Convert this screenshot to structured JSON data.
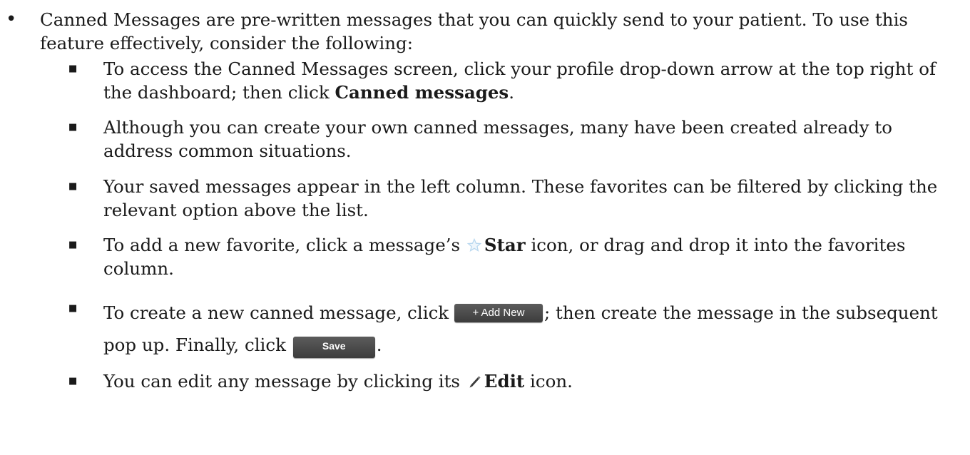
{
  "intro": {
    "text": "Canned Messages are pre-written messages that you can quickly send to your patient. To use this feature effectively, consider the following:"
  },
  "items": [
    {
      "pre": "To access the Canned Messages screen, click your profile drop-down arrow at the top right of the dashboard; then click ",
      "bold": "Canned messages",
      "post": "."
    },
    {
      "text": "Although you can create your own canned messages, many have been created already to address common situations."
    },
    {
      "text": "Your saved messages appear in the left column. These favorites can be filtered by clicking the relevant option above the list."
    },
    {
      "pre": "To add a new favorite, click a message’s ",
      "icon": "star-icon",
      "bold": "Star",
      "post": " icon, or drag and drop it into the favorites column."
    },
    {
      "pre": "To create a new canned message, click ",
      "button1": "+ Add New",
      "mid": "; then create the message in the subsequent pop up. Finally, click ",
      "button2": "Save",
      "post": "."
    },
    {
      "pre": "You can edit any message by clicking its ",
      "icon": "pencil-icon",
      "bold": "Edit",
      "post": " icon."
    }
  ],
  "colors": {
    "text": "#1a1a1a",
    "button_bg": "#4a4a4a",
    "button_text": "#ffffff",
    "star_icon": "#b9d8ef"
  }
}
